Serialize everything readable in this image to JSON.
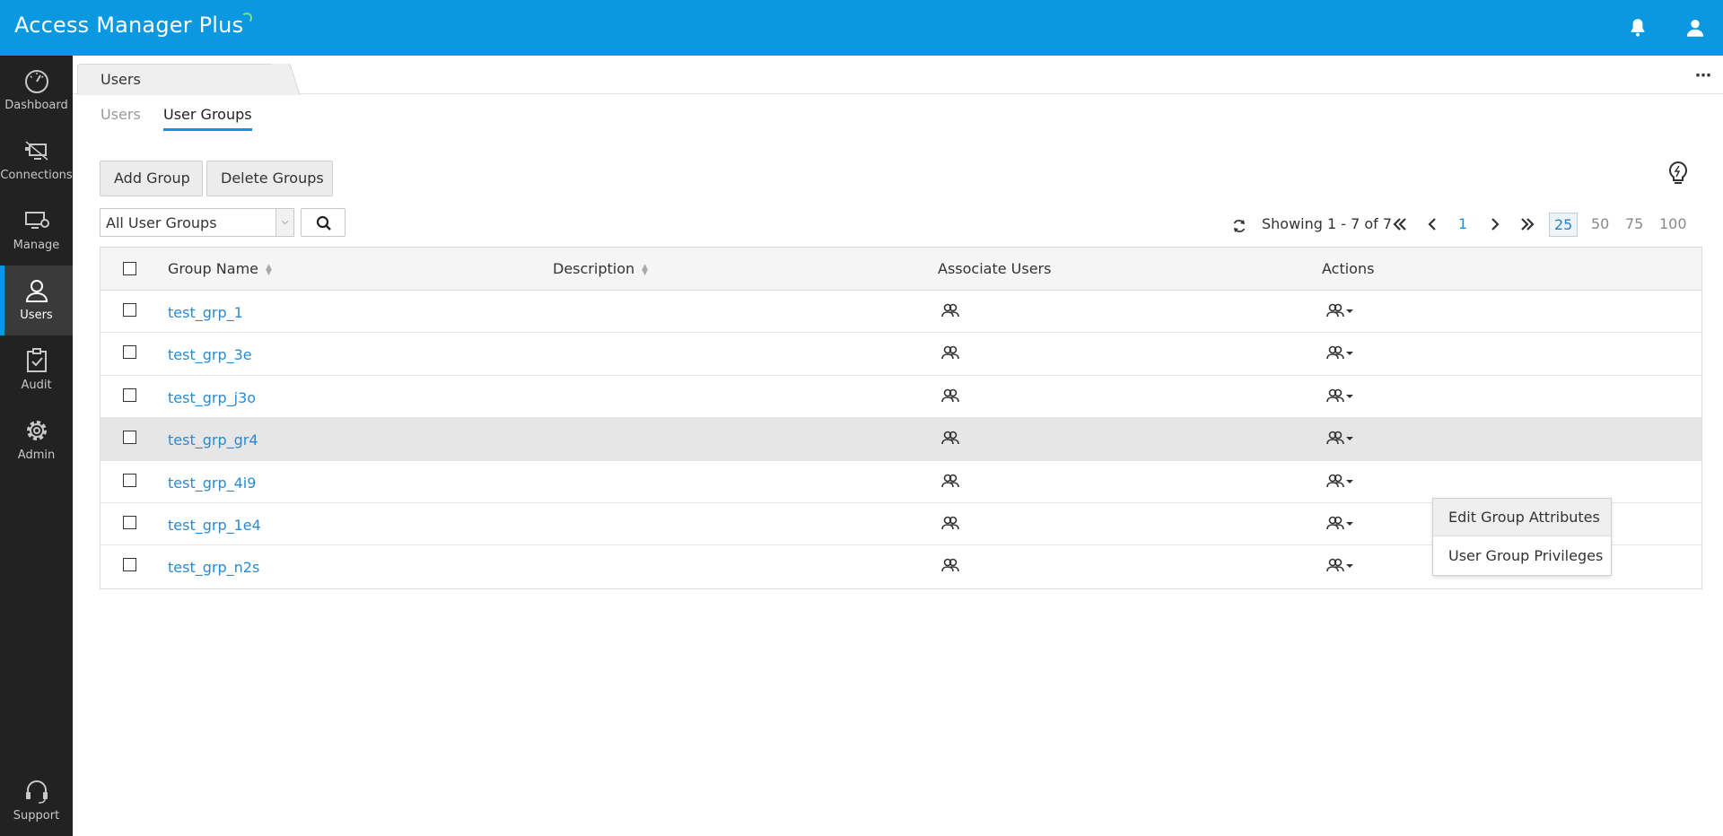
{
  "header": {
    "app_title": "Access Manager Plus",
    "icons": [
      "bell-icon",
      "user-icon"
    ]
  },
  "sidebar": {
    "items": [
      {
        "label": "Dashboard",
        "icon": "gauge-icon"
      },
      {
        "label": "Connections",
        "icon": "connections-icon"
      },
      {
        "label": "Manage",
        "icon": "manage-icon"
      },
      {
        "label": "Users",
        "icon": "user-icon",
        "active": true
      },
      {
        "label": "Audit",
        "icon": "clipboard-check-icon"
      },
      {
        "label": "Admin",
        "icon": "gear-icon"
      }
    ],
    "support": {
      "label": "Support",
      "icon": "headset-icon"
    }
  },
  "page_tab": {
    "label": "Users"
  },
  "subtabs": {
    "users": "Users",
    "user_groups": "User Groups"
  },
  "toolbar": {
    "add_group": "Add Group",
    "delete_groups": "Delete Groups"
  },
  "filter": {
    "selected": "All User Groups"
  },
  "pager": {
    "showing": "Showing 1 - 7 of 7",
    "page": "1",
    "sizes": [
      "25",
      "50",
      "75",
      "100"
    ],
    "active_size": "25"
  },
  "table": {
    "columns": {
      "name": "Group Name",
      "description": "Description",
      "associate": "Associate Users",
      "actions": "Actions"
    },
    "rows": [
      {
        "name": "test_grp_1",
        "description": ""
      },
      {
        "name": "test_grp_3e",
        "description": ""
      },
      {
        "name": "test_grp_j3o",
        "description": ""
      },
      {
        "name": "test_grp_gr4",
        "description": "",
        "highlighted": true
      },
      {
        "name": "test_grp_4i9",
        "description": ""
      },
      {
        "name": "test_grp_1e4",
        "description": ""
      },
      {
        "name": "test_grp_n2s",
        "description": ""
      }
    ]
  },
  "actions_menu": {
    "items": [
      "Edit Group Attributes",
      "User Group Privileges"
    ]
  },
  "colors": {
    "accent": "#0a98e0",
    "sidebar": "#222222",
    "link": "#2a8ad0"
  }
}
